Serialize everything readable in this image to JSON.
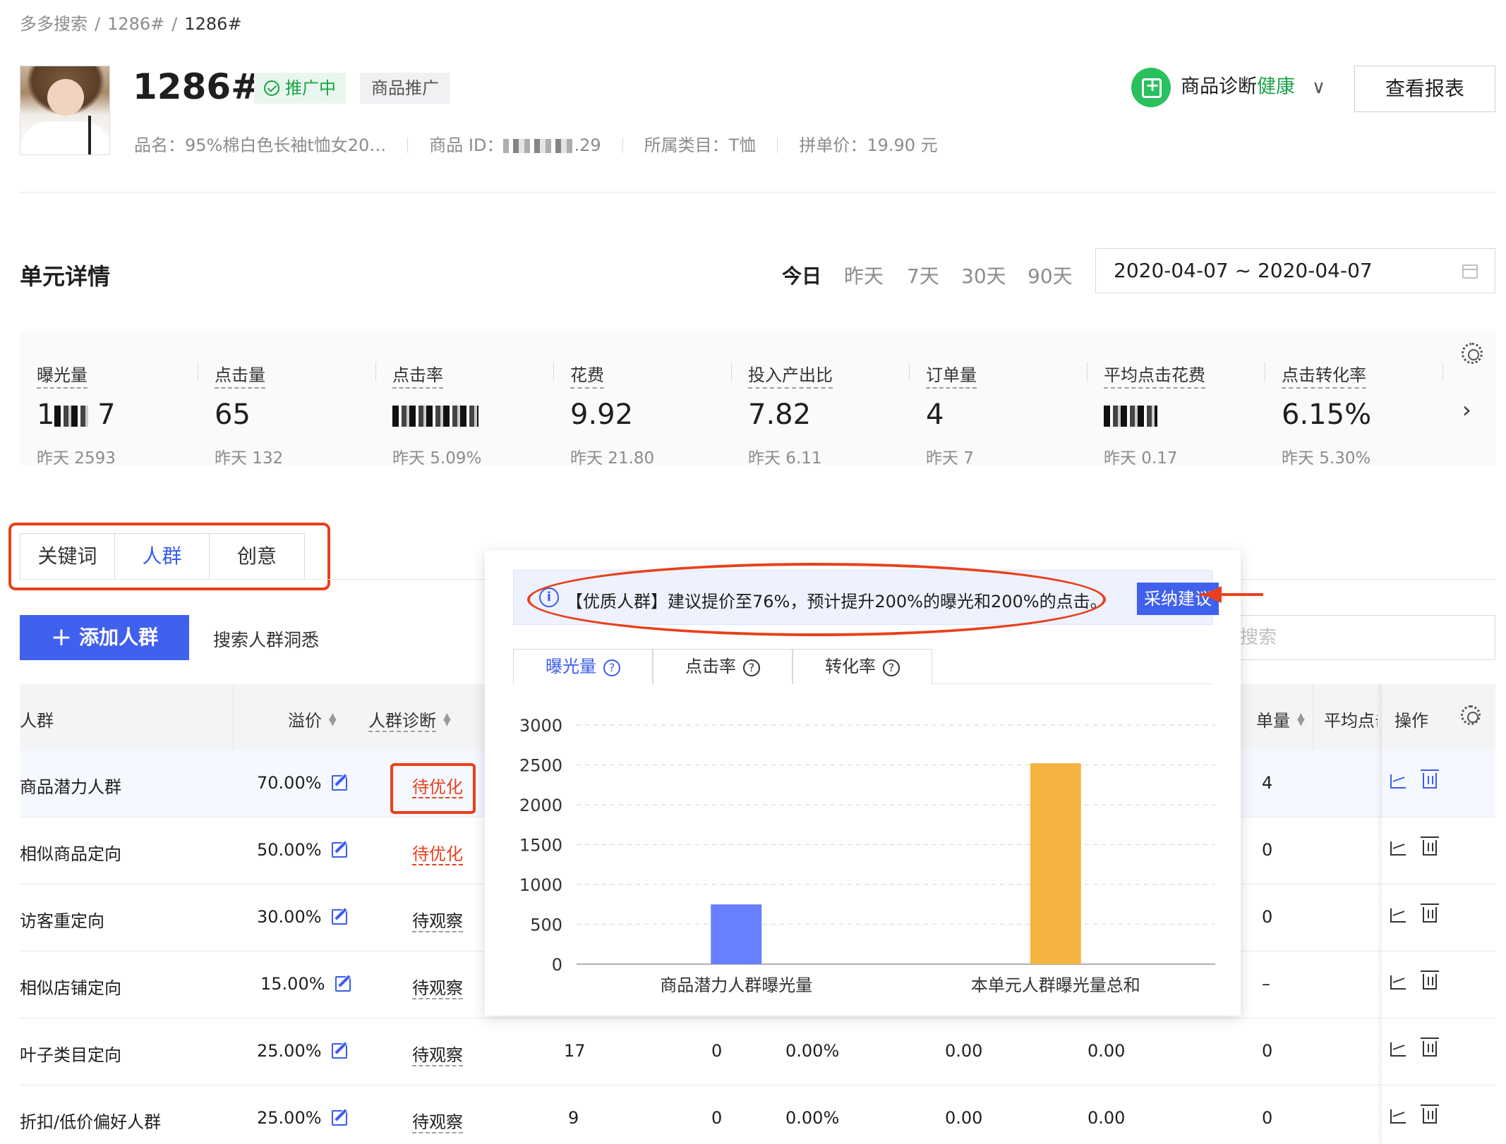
{
  "breadcrumb": {
    "root": "多多搜索",
    "level1": "1286#",
    "current": "1286#",
    "sep": "/"
  },
  "header": {
    "title": "1286#",
    "status_badge": "推广中",
    "type_badge": "商品推广",
    "meta": {
      "name": "品名：95%棉白色长袖t恤女20…",
      "id_label": "商品 ID：",
      "id_tail": ".29",
      "category": "所属类目：T恤",
      "price": "拼单价：19.90 元"
    },
    "diag_label": "商品诊断",
    "diag_status": "健康",
    "report_button": "查看报表"
  },
  "unit": {
    "title": "单元详情",
    "ranges": [
      "今日",
      "昨天",
      "7天",
      "30天",
      "90天"
    ],
    "active_range": "今日",
    "date_range": "2020-04-07 ~ 2020-04-07"
  },
  "metrics": [
    {
      "label": "曝光量",
      "value": "1░░ 7",
      "yesterday": "昨天 2593",
      "blurred": true
    },
    {
      "label": "点击量",
      "value": "65",
      "yesterday": "昨天 132"
    },
    {
      "label": "点击率",
      "value": "",
      "yesterday": "昨天 5.09%",
      "blurred": true
    },
    {
      "label": "花费",
      "value": "9.92",
      "yesterday": "昨天 21.80"
    },
    {
      "label": "投入产出比",
      "value": "7.82",
      "yesterday": "昨天 6.11"
    },
    {
      "label": "订单量",
      "value": "4",
      "yesterday": "昨天 7"
    },
    {
      "label": "平均点击花费",
      "value": "",
      "yesterday": "昨天 0.17",
      "blurred": true
    },
    {
      "label": "点击转化率",
      "value": "6.15%",
      "yesterday": "昨天 5.30%"
    }
  ],
  "tabs": [
    "关键词",
    "人群",
    "创意"
  ],
  "active_tab": "人群",
  "toolbar": {
    "add_button": "添加人群",
    "insight_link": "搜索人群洞悉",
    "search_placeholder": "搜索"
  },
  "table": {
    "headers": {
      "crowd": "人群",
      "premium": "溢价",
      "diagnosis": "人群诊断",
      "orders": "单量",
      "avg_click": "平均点击",
      "ops": "操作"
    },
    "rows": [
      {
        "name": "商品潜力人群",
        "premium": "70.00%",
        "diag": "待优化",
        "diag_type": "red",
        "c1": "",
        "c2": "",
        "c3": "",
        "c4": "",
        "c5": "",
        "orders": "4"
      },
      {
        "name": "相似商品定向",
        "premium": "50.00%",
        "diag": "待优化",
        "diag_type": "red",
        "c1": "",
        "c2": "",
        "c3": "",
        "c4": "",
        "c5": "",
        "orders": "0"
      },
      {
        "name": "访客重定向",
        "premium": "30.00%",
        "diag": "待观察",
        "diag_type": "gray",
        "c1": "",
        "c2": "",
        "c3": "",
        "c4": "",
        "c5": "",
        "orders": "0"
      },
      {
        "name": "相似店铺定向",
        "premium": "15.00%",
        "diag": "待观察",
        "diag_type": "gray",
        "c1": "",
        "c2": "",
        "c3": "",
        "c4": "",
        "c5": "",
        "orders": "–"
      },
      {
        "name": "叶子类目定向",
        "premium": "25.00%",
        "diag": "待观察",
        "diag_type": "gray",
        "c1": "17",
        "c2": "0",
        "c3": "0.00%",
        "c4": "0.00",
        "c5": "0.00",
        "orders": "0"
      },
      {
        "name": "折扣/低价偏好人群",
        "premium": "25.00%",
        "diag": "待观察",
        "diag_type": "gray",
        "c1": "9",
        "c2": "0",
        "c3": "0.00%",
        "c4": "0.00",
        "c5": "0.00",
        "orders": "0"
      }
    ]
  },
  "popover": {
    "notice": "【优质人群】建议提价至76%，预计提升200%的曝光和200%的点击。",
    "adopt_button": "采纳建议",
    "tabs": [
      "曝光量",
      "点击率",
      "转化率"
    ],
    "active_tab": "曝光量"
  },
  "colors": {
    "accent": "#4060ee",
    "danger": "#e8401c",
    "success": "#1aa34a",
    "bar1": "#6680ff",
    "bar2": "#f5b342"
  },
  "chart_data": {
    "type": "bar",
    "categories": [
      "商品潜力人群曝光量",
      "本单元人群曝光量总和"
    ],
    "values": [
      750,
      2520
    ],
    "colors": [
      "#6680ff",
      "#f5b342"
    ],
    "ylim": [
      0,
      3000
    ],
    "yticks": [
      0,
      500,
      1000,
      1500,
      2000,
      2500,
      3000
    ],
    "grid": true
  }
}
